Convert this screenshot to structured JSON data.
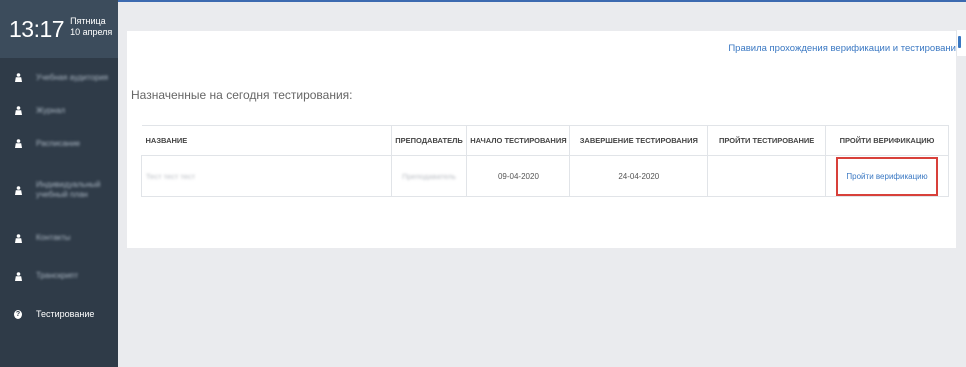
{
  "clock": {
    "time": "13:17",
    "weekday": "Пятница",
    "date": "10 апреля"
  },
  "sidebar": {
    "items": [
      {
        "label": "Учебная аудитория",
        "active": false
      },
      {
        "label": "Журнал",
        "active": false
      },
      {
        "label": "Расписание",
        "active": false
      },
      {
        "label": "Индивидуальный учебный план",
        "active": false
      },
      {
        "label": "Контакты",
        "active": false
      },
      {
        "label": "Транскрипт",
        "active": false
      },
      {
        "label": "Тестирование",
        "active": true
      }
    ]
  },
  "header": {
    "rules_link": "Правила прохождения верификации и тестировани"
  },
  "main": {
    "section_title": "Назначенные на сегодня тестирования:",
    "table": {
      "columns": [
        "НАЗВАНИЕ",
        "ПРЕПОДАВАТЕЛЬ",
        "НАЧАЛО ТЕСТИРОВАНИЯ",
        "ЗАВЕРШЕНИЕ ТЕСТИРОВАНИЯ",
        "ПРОЙТИ ТЕСТИРОВАНИЕ",
        "ПРОЙТИ ВЕРИФИКАЦИЮ"
      ],
      "rows": [
        {
          "name": "Тест тест тест",
          "teacher": "Преподаватель",
          "start": "09-04-2020",
          "end": "24-04-2020",
          "take": "",
          "verify": "Пройти верификацию"
        }
      ]
    }
  },
  "colors": {
    "sidebar_bg": "#2f3b48",
    "clock_bg": "#3c4c5c",
    "link": "#3a78c3",
    "highlight": "#d8403a",
    "top_accent": "#3d6ab0"
  },
  "icons": {
    "sidebar_item": "user-icon",
    "active_item": "question-icon"
  }
}
